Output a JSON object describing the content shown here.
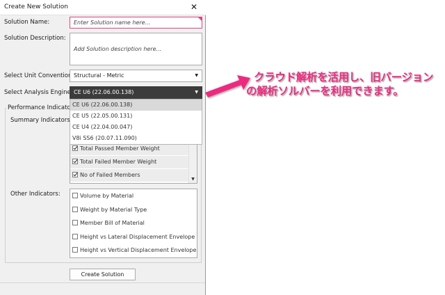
{
  "window": {
    "title": "Create New Solution",
    "close_glyph": "✕"
  },
  "form": {
    "name_label": "Solution Name:",
    "name_placeholder": "Enter Solution name here...",
    "description_label": "Solution Description:",
    "description_placeholder": "Add Solution description here...",
    "unit_label": "Select Unit Convention:",
    "unit_value": "Structural - Metric",
    "engine_label": "Select Analysis Engine:",
    "engine_value": "CE U6 (22.06.00.138)",
    "engine_options": [
      "CE U6 (22.06.00.138)",
      "CE U5 (22.05.00.131)",
      "CE U4 (22.04.00.047)",
      "V8i SS6 (20.07.11.090)"
    ],
    "performance_label": "Performance Indicators:",
    "summary_label": "Summary Indicators:",
    "summary_items": [
      {
        "label": "Total Passed Member Weight",
        "checked": true
      },
      {
        "label": "Total Failed Member Weight",
        "checked": true
      },
      {
        "label": "No of Failed Members",
        "checked": true
      }
    ],
    "other_label": "Other Indicators:",
    "other_items": [
      {
        "label": "Volume by Material",
        "checked": false
      },
      {
        "label": "Weight by Material Type",
        "checked": false
      },
      {
        "label": "Member Bill of Material",
        "checked": false
      },
      {
        "label": "Height vs Lateral Displacement Envelope",
        "checked": false
      },
      {
        "label": "Height vs Vertical Displacement Envelope",
        "checked": false
      }
    ],
    "create_button": "Create Solution"
  },
  "callout": {
    "line1": "クラウド解析を活用し、旧バージョン",
    "line2": "の解析ソルバーを利用できます。",
    "color": "#ee2c7f"
  }
}
